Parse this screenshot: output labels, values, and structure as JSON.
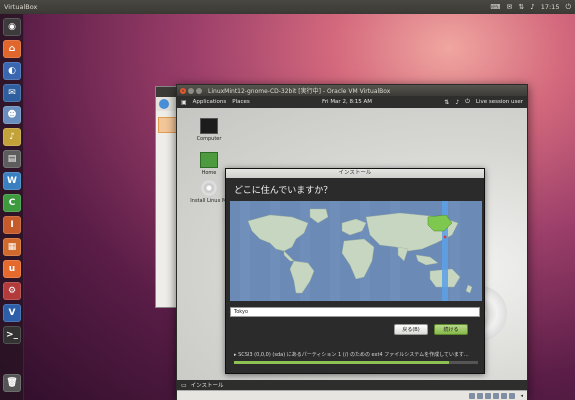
{
  "top_panel": {
    "app_name": "VirtualBox",
    "clock": "17:15",
    "tray_icons": [
      "keyboard-icon",
      "mail-icon",
      "network-icon",
      "volume-icon",
      "power-icon"
    ]
  },
  "launcher": {
    "items": [
      {
        "name": "dash-home-icon",
        "color": "#3d3a3c",
        "glyph": "◉"
      },
      {
        "name": "files-icon",
        "color": "#e0662b",
        "glyph": "⌂"
      },
      {
        "name": "firefox-icon",
        "color": "#3a67b0",
        "glyph": "◐"
      },
      {
        "name": "thunderbird-icon",
        "color": "#2f5f9e",
        "glyph": "✉"
      },
      {
        "name": "empathy-icon",
        "color": "#6a8fbf",
        "glyph": "☻"
      },
      {
        "name": "rhythmbox-icon",
        "color": "#c4a23a",
        "glyph": "♪"
      },
      {
        "name": "terminal-printer-icon",
        "color": "#5d5d5d",
        "glyph": "▤"
      },
      {
        "name": "writer-icon",
        "color": "#3a7fc0",
        "glyph": "W"
      },
      {
        "name": "calc-icon",
        "color": "#3e9a3e",
        "glyph": "C"
      },
      {
        "name": "impress-icon",
        "color": "#c55a2a",
        "glyph": "I"
      },
      {
        "name": "software-center-icon",
        "color": "#d06a2c",
        "glyph": "▦"
      },
      {
        "name": "ubuntu-one-icon",
        "color": "#e5692c",
        "glyph": "u"
      },
      {
        "name": "settings-icon",
        "color": "#b23b3b",
        "glyph": "⚙"
      },
      {
        "name": "virtualbox-icon",
        "color": "#2c5fa8",
        "glyph": "V"
      },
      {
        "name": "terminal-icon",
        "color": "#333333",
        "glyph": ">_"
      },
      {
        "name": "trash-icon",
        "color": "#555555",
        "glyph": "🗑"
      }
    ]
  },
  "vm_window": {
    "title": "LinuxMint12-gnome-CD-32bit [実行中] - Oracle VM VirtualBox",
    "guest_panel": {
      "applications": "Applications",
      "places": "Places",
      "datetime": "Fri Mar 2, 8:15 AM",
      "session": "Live session user"
    },
    "desktop_icons": [
      {
        "label": "Computer"
      },
      {
        "label": "Home"
      },
      {
        "label": "Install Linux Mi"
      }
    ],
    "taskbar_item": "インストール"
  },
  "installer": {
    "window_title": "インストール",
    "heading": "どこに住んでいますか？",
    "city_value": "Tokyo",
    "back_label": "戻る(B)",
    "next_label": "続ける",
    "status_text": "▸ SCSI3 (0,0,0) (sda) にあるパーティション 1 (/) のための ext4 ファイルシステムを作成しています...",
    "progress": 0.88
  },
  "colors": {
    "accent_green": "#8dc153",
    "highlight_green": "#7ec850",
    "timezone_blue": "#5aa0e8",
    "map_ocean": "#6b8ab6",
    "map_land": "#c7d6c0"
  }
}
